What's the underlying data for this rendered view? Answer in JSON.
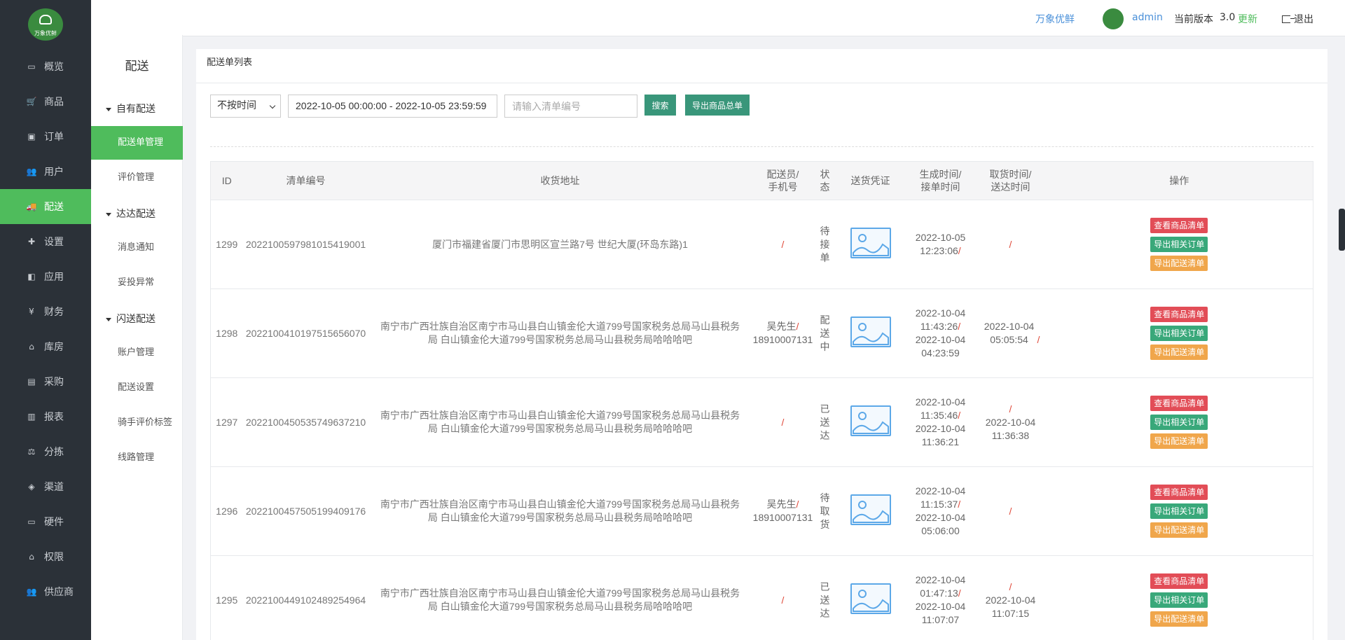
{
  "nav": {
    "logo_text": "万象优鲜",
    "items": [
      {
        "label": "概览",
        "icon": "monitor-icon"
      },
      {
        "label": "商品",
        "icon": "cart-icon"
      },
      {
        "label": "订单",
        "icon": "money-icon"
      },
      {
        "label": "用户",
        "icon": "users-icon"
      },
      {
        "label": "配送",
        "icon": "truck-icon"
      },
      {
        "label": "设置",
        "icon": "puzzle-icon"
      },
      {
        "label": "应用",
        "icon": "app-icon"
      },
      {
        "label": "财务",
        "icon": "yen-icon"
      },
      {
        "label": "库房",
        "icon": "home-icon"
      },
      {
        "label": "采购",
        "icon": "bus-icon"
      },
      {
        "label": "报表",
        "icon": "chart-icon"
      },
      {
        "label": "分拣",
        "icon": "scale-icon"
      },
      {
        "label": "渠道",
        "icon": "cube-icon"
      },
      {
        "label": "硬件",
        "icon": "desktop-icon"
      },
      {
        "label": "权限",
        "icon": "bank-icon"
      },
      {
        "label": "供应商",
        "icon": "users-icon"
      }
    ]
  },
  "subnav": {
    "title": "配送",
    "groups": [
      {
        "label": "自有配送",
        "items": [
          "配送单管理",
          "评价管理"
        ]
      },
      {
        "label": "达达配送",
        "items": [
          "消息通知",
          "妥投异常"
        ]
      },
      {
        "label": "闪送配送",
        "items": [
          "账户管理",
          "配送设置",
          "骑手评价标签",
          "线路管理"
        ]
      }
    ]
  },
  "header": {
    "brand": "万象优鲜",
    "user": "admin",
    "version_label": "当前版本",
    "version": "3.0",
    "update": "更新",
    "logout": "退出"
  },
  "main": {
    "title": "配送单列表",
    "time_select": "不按时间",
    "date_range": "2022-10-05 00:00:00 - 2022-10-05 23:59:59",
    "search_placeholder": "请输入清单编号",
    "search_btn": "搜索",
    "export_btn": "导出商品总单"
  },
  "table": {
    "headers": {
      "id": "ID",
      "no": "清单编号",
      "address": "收货地址",
      "courier_1": "配送员/",
      "courier_2": "手机号",
      "status": "状态",
      "proof": "送货凭证",
      "created_1": "生成时间/",
      "created_2": "接单时间",
      "pickup_1": "取货时间/",
      "pickup_2": "送达时间",
      "ops": "操作"
    },
    "ops_labels": {
      "view": "查看商品清单",
      "export_orders": "导出相关订单",
      "export_delivery": "导出配送清单"
    },
    "rows": [
      {
        "id": "1299",
        "no": "2022100597981015419001",
        "address": "厦门市福建省厦门市思明区宣兰路7号 世纪大厦(环岛东路)1",
        "courier": "",
        "phone": "",
        "status": [
          "待",
          "接",
          "单"
        ],
        "created": "2022-10-05",
        "created_time": "12:23:06",
        "accepted": "",
        "accepted_time": "",
        "pickup": "",
        "delivered": ""
      },
      {
        "id": "1298",
        "no": "2022100410197515656070",
        "address": "南宁市广西壮族自治区南宁市马山县白山镇金伦大道799号国家税务总局马山县税务局 白山镇金伦大道799号国家税务总局马山县税务局哈哈哈吧",
        "courier": "吴先生",
        "phone": "18910007131",
        "status": [
          "配",
          "送",
          "中"
        ],
        "created": "2022-10-04",
        "created_time": "11:43:26",
        "accepted": "2022-10-04",
        "accepted_time": "04:23:59",
        "pickup": "2022-10-04 05:05:54",
        "delivered": ""
      },
      {
        "id": "1297",
        "no": "2022100450535749637210",
        "address": "南宁市广西壮族自治区南宁市马山县白山镇金伦大道799号国家税务总局马山县税务局 白山镇金伦大道799号国家税务总局马山县税务局哈哈哈吧",
        "courier": "",
        "phone": "",
        "status": [
          "已",
          "送",
          "达"
        ],
        "created": "2022-10-04",
        "created_time": "11:35:46",
        "accepted": "2022-10-04",
        "accepted_time": "11:36:21",
        "pickup": "",
        "delivered": "2022-10-04 11:36:38"
      },
      {
        "id": "1296",
        "no": "2022100457505199409176",
        "address": "南宁市广西壮族自治区南宁市马山县白山镇金伦大道799号国家税务总局马山县税务局 白山镇金伦大道799号国家税务总局马山县税务局哈哈哈吧",
        "courier": "吴先生",
        "phone": "18910007131",
        "status": [
          "待",
          "取",
          "货"
        ],
        "created": "2022-10-04",
        "created_time": "11:15:37",
        "accepted": "2022-10-04",
        "accepted_time": "05:06:00",
        "pickup": "",
        "delivered": ""
      },
      {
        "id": "1295",
        "no": "2022100449102489254964",
        "address": "南宁市广西壮族自治区南宁市马山县白山镇金伦大道799号国家税务总局马山县税务局 白山镇金伦大道799号国家税务总局马山县税务局哈哈哈吧",
        "courier": "",
        "phone": "",
        "status": [
          "已",
          "送",
          "达"
        ],
        "created": "2022-10-04",
        "created_time": "01:47:13",
        "accepted": "2022-10-04",
        "accepted_time": "11:07:07",
        "pickup": "",
        "delivered": "2022-10-04 11:07:15"
      }
    ]
  },
  "colors": {
    "accent_green": "#4fbc5c",
    "teal_button": "#39967a",
    "nav_bg": "#2b3138",
    "red": "#e24d57",
    "orange": "#f0a64b"
  }
}
